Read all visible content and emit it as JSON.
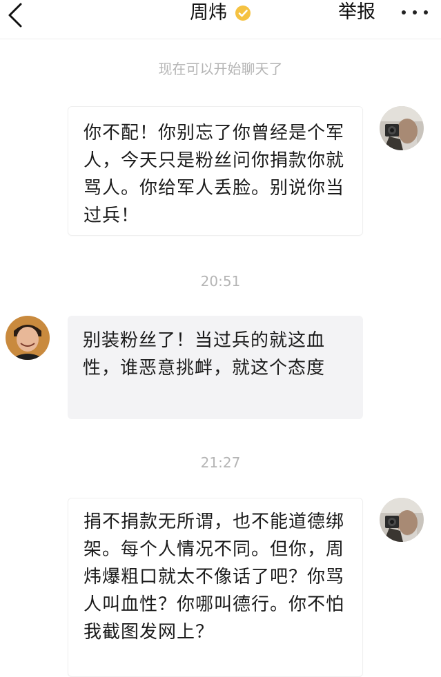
{
  "header": {
    "back_icon": "chevron-left-icon",
    "title": "周炜",
    "verified_icon": "verified-badge-icon",
    "report_label": "举报",
    "more_icon": "more-dots-icon"
  },
  "chat": {
    "system_notice": "现在可以开始聊天了",
    "messages": [
      {
        "side": "right",
        "text": "你不配！你别忘了你曾经是个军人，今天只是粉丝问你捐款你就骂人。你给军人丢脸。别说你当过兵！"
      },
      {
        "timestamp": "20:51"
      },
      {
        "side": "left",
        "text": "别装粉丝了！当过兵的就这血性，谁恶意挑衅，就这个态度"
      },
      {
        "timestamp": "21:27"
      },
      {
        "side": "right",
        "text": "捐不捐款无所谓，也不能道德绑架。每个人情况不同。但你，周炜爆粗口就太不像话了吧？你骂人叫血性？你哪叫德行。你不怕我截图发网上？"
      }
    ]
  },
  "colors": {
    "bubble_recv_bg": "#f3f3f5",
    "bubble_sent_bg": "#ffffff",
    "system_text": "#b4b4b4",
    "verified_badge": "#f5c242"
  }
}
